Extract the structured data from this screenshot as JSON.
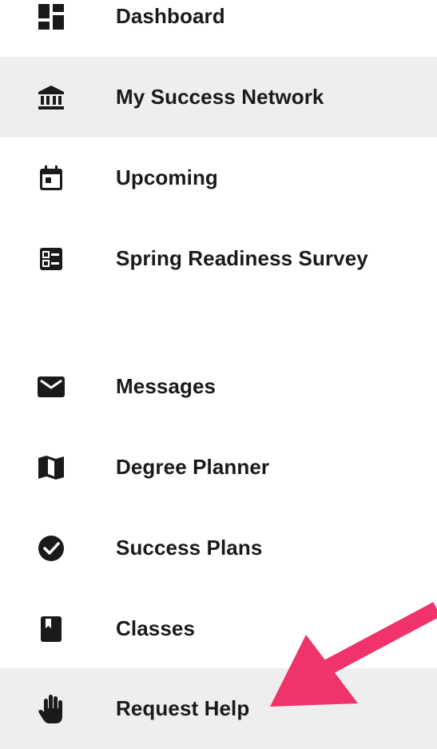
{
  "nav": {
    "items": [
      {
        "label": "Dashboard",
        "icon": "dashboard-icon",
        "highlighted": false
      },
      {
        "label": "My Success Network",
        "icon": "institution-icon",
        "highlighted": true
      },
      {
        "label": "Upcoming",
        "icon": "calendar-icon",
        "highlighted": false
      },
      {
        "label": "Spring Readiness Survey",
        "icon": "survey-list-icon",
        "highlighted": false
      },
      {
        "label": "Messages",
        "icon": "envelope-icon",
        "highlighted": false
      },
      {
        "label": "Degree Planner",
        "icon": "map-icon",
        "highlighted": false
      },
      {
        "label": "Success Plans",
        "icon": "check-circle-icon",
        "highlighted": false
      },
      {
        "label": "Classes",
        "icon": "book-icon",
        "highlighted": false
      },
      {
        "label": "Request Help",
        "icon": "raised-hand-icon",
        "highlighted": true
      }
    ]
  },
  "colors": {
    "highlight_bg": "#eeeeee",
    "text": "#1a1a1a",
    "icon": "#1a1a1a",
    "arrow": "#f0336b"
  },
  "annotation": {
    "arrow_target": "Request Help"
  }
}
